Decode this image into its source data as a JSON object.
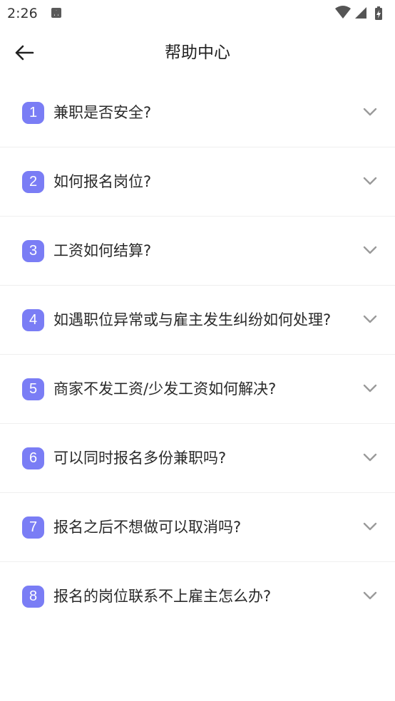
{
  "status_bar": {
    "time": "2:26",
    "notification_icon": "a-letter-icon",
    "icons": [
      "wifi-icon",
      "signal-icon",
      "battery-charging-icon"
    ]
  },
  "app_bar": {
    "back_icon": "arrow-left-icon",
    "title": "帮助中心"
  },
  "faq": {
    "items": [
      {
        "number": "1",
        "question": "兼职是否安全?"
      },
      {
        "number": "2",
        "question": "如何报名岗位?"
      },
      {
        "number": "3",
        "question": "工资如何结算?"
      },
      {
        "number": "4",
        "question": "如遇职位异常或与雇主发生纠纷如何处理?"
      },
      {
        "number": "5",
        "question": "商家不发工资/少发工资如何解决?"
      },
      {
        "number": "6",
        "question": "可以同时报名多份兼职吗?"
      },
      {
        "number": "7",
        "question": "报名之后不想做可以取消吗?"
      },
      {
        "number": "8",
        "question": "报名的岗位联系不上雇主怎么办?"
      }
    ],
    "expand_icon": "chevron-down-icon"
  },
  "colors": {
    "badge": "#7a7df5",
    "text": "#2a2a2a",
    "divider": "#efefef",
    "chevron": "#9a9a9a"
  }
}
